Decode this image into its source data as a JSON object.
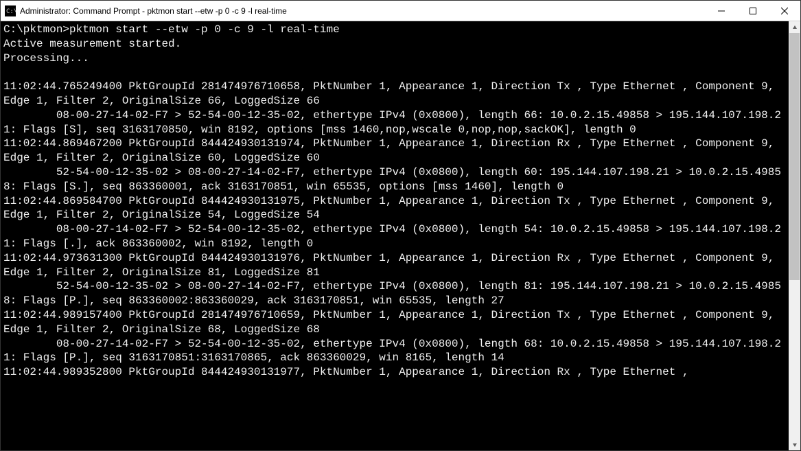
{
  "window": {
    "title": "Administrator: Command Prompt - pktmon  start --etw -p 0 -c 9 -l real-time"
  },
  "console": {
    "prompt": "C:\\pktmon>",
    "command": "pktmon start --etw -p 0 -c 9 -l real-time",
    "status1": "Active measurement started.",
    "status2": "Processing...",
    "lines": [
      "11:02:44.765249400 PktGroupId 281474976710658, PktNumber 1, Appearance 1, Direction Tx , Type Ethernet , Component 9, Edge 1, Filter 2, OriginalSize 66, LoggedSize 66",
      "\t08-00-27-14-02-F7 > 52-54-00-12-35-02, ethertype IPv4 (0x0800), length 66: 10.0.2.15.49858 > 195.144.107.198.21: Flags [S], seq 3163170850, win 8192, options [mss 1460,nop,wscale 0,nop,nop,sackOK], length 0",
      "11:02:44.869467200 PktGroupId 844424930131974, PktNumber 1, Appearance 1, Direction Rx , Type Ethernet , Component 9, Edge 1, Filter 2, OriginalSize 60, LoggedSize 60",
      "\t52-54-00-12-35-02 > 08-00-27-14-02-F7, ethertype IPv4 (0x0800), length 60: 195.144.107.198.21 > 10.0.2.15.49858: Flags [S.], seq 863360001, ack 3163170851, win 65535, options [mss 1460], length 0",
      "11:02:44.869584700 PktGroupId 844424930131975, PktNumber 1, Appearance 1, Direction Tx , Type Ethernet , Component 9, Edge 1, Filter 2, OriginalSize 54, LoggedSize 54",
      "\t08-00-27-14-02-F7 > 52-54-00-12-35-02, ethertype IPv4 (0x0800), length 54: 10.0.2.15.49858 > 195.144.107.198.21: Flags [.], ack 863360002, win 8192, length 0",
      "11:02:44.973631300 PktGroupId 844424930131976, PktNumber 1, Appearance 1, Direction Rx , Type Ethernet , Component 9, Edge 1, Filter 2, OriginalSize 81, LoggedSize 81",
      "\t52-54-00-12-35-02 > 08-00-27-14-02-F7, ethertype IPv4 (0x0800), length 81: 195.144.107.198.21 > 10.0.2.15.49858: Flags [P.], seq 863360002:863360029, ack 3163170851, win 65535, length 27",
      "11:02:44.989157400 PktGroupId 281474976710659, PktNumber 1, Appearance 1, Direction Tx , Type Ethernet , Component 9, Edge 1, Filter 2, OriginalSize 68, LoggedSize 68",
      "\t08-00-27-14-02-F7 > 52-54-00-12-35-02, ethertype IPv4 (0x0800), length 68: 10.0.2.15.49858 > 195.144.107.198.21: Flags [P.], seq 3163170851:3163170865, ack 863360029, win 8165, length 14",
      "11:02:44.989352800 PktGroupId 844424930131977, PktNumber 1, Appearance 1, Direction Rx , Type Ethernet ,"
    ]
  }
}
